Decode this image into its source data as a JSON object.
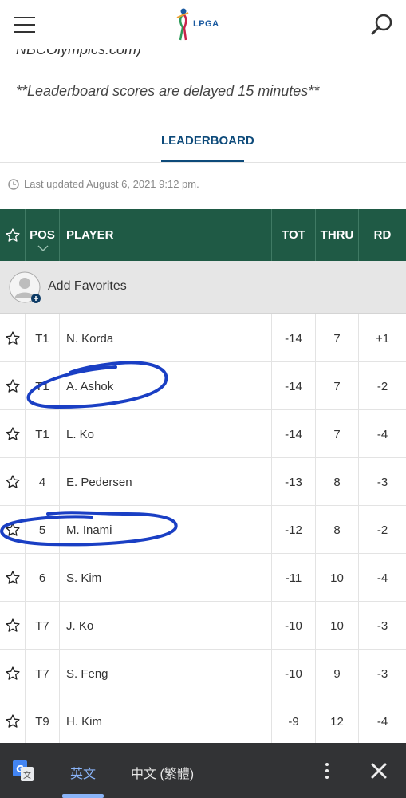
{
  "header": {
    "logo_text": "LPGA"
  },
  "intro": {
    "cut_text": "NBCOlympics.com)",
    "delay_note": "**Leaderboard scores are delayed 15 minutes**"
  },
  "tab": {
    "label": "LEADERBOARD"
  },
  "updated": {
    "text": "Last updated August 6, 2021 9:12 pm."
  },
  "table": {
    "headers": {
      "pos": "POS",
      "player": "PLAYER",
      "tot": "TOT",
      "thru": "THRU",
      "rd": "RD"
    },
    "favorites_label": "Add Favorites",
    "rows": [
      {
        "pos": "T1",
        "player": "N. Korda",
        "tot": "-14",
        "thru": "7",
        "rd": "+1"
      },
      {
        "pos": "T1",
        "player": "A. Ashok",
        "tot": "-14",
        "thru": "7",
        "rd": "-2"
      },
      {
        "pos": "T1",
        "player": "L. Ko",
        "tot": "-14",
        "thru": "7",
        "rd": "-4"
      },
      {
        "pos": "4",
        "player": "E. Pedersen",
        "tot": "-13",
        "thru": "8",
        "rd": "-3"
      },
      {
        "pos": "5",
        "player": "M. Inami",
        "tot": "-12",
        "thru": "8",
        "rd": "-2"
      },
      {
        "pos": "6",
        "player": "S. Kim",
        "tot": "-11",
        "thru": "10",
        "rd": "-4"
      },
      {
        "pos": "T7",
        "player": "J. Ko",
        "tot": "-10",
        "thru": "10",
        "rd": "-3"
      },
      {
        "pos": "T7",
        "player": "S. Feng",
        "tot": "-10",
        "thru": "9",
        "rd": "-3"
      },
      {
        "pos": "T9",
        "player": "H. Kim",
        "tot": "-9",
        "thru": "12",
        "rd": "-4"
      }
    ]
  },
  "translate_bar": {
    "source_lang": "英文",
    "target_lang": "中文 (繁體)"
  },
  "colors": {
    "header_green": "#1f5a45",
    "tab_blue": "#0d4a7a",
    "annotation_blue": "#1a3fc4"
  }
}
